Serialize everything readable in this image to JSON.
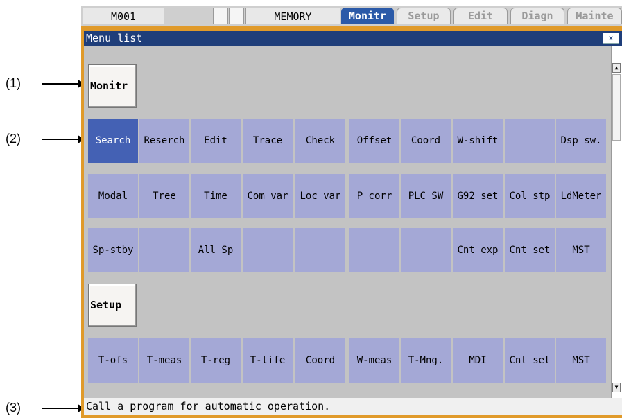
{
  "callouts": [
    "(1)",
    "(2)",
    "(3)"
  ],
  "topbar": {
    "machine": "M001",
    "mode": "MEMORY",
    "tabs": [
      "Monitr",
      "Setup",
      "Edit",
      "Diagn",
      "Mainte"
    ],
    "active_tab": "Monitr"
  },
  "window": {
    "title": "Menu list",
    "close_icon": "×",
    "scroll_up_icon": "▲",
    "scroll_down_icon": "▼",
    "status": "Call a program for automatic operation."
  },
  "groups": [
    {
      "header": "Monitr",
      "rows": [
        [
          "Search",
          "Reserch",
          "Edit",
          "Trace",
          "Check",
          "Offset",
          "Coord",
          "W-shift",
          "",
          "Dsp sw."
        ],
        [
          "Modal",
          "Tree",
          "Time",
          "Com var",
          "Loc var",
          "P corr",
          "PLC SW",
          "G92 set",
          "Col stp",
          "LdMeter"
        ],
        [
          "Sp-stby",
          "",
          "All Sp",
          "",
          "",
          "",
          "",
          "Cnt exp",
          "Cnt set",
          "MST"
        ]
      ]
    },
    {
      "header": "Setup",
      "rows": [
        [
          "T-ofs",
          "T-meas",
          "T-reg",
          "T-life",
          "Coord",
          "W-meas",
          "T-Mng.",
          "MDI",
          "Cnt set",
          "MST"
        ]
      ]
    }
  ],
  "selected_item": "Search",
  "colors": {
    "window_frame": "#e09a2a",
    "titlebar": "#1f3e7a",
    "menu_item": "#a4a8d6",
    "menu_item_selected": "#4461b4",
    "active_tab": "#2b5aa8"
  }
}
